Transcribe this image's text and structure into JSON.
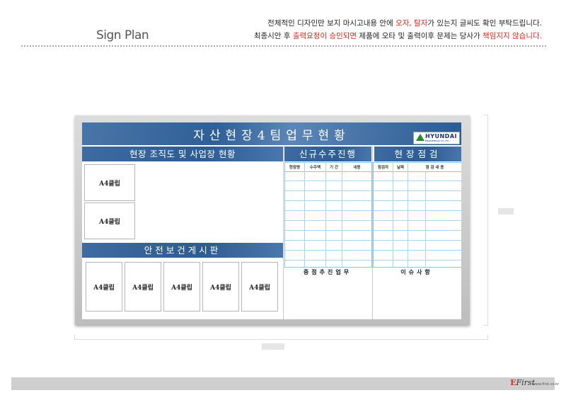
{
  "page": {
    "title": "Sign Plan"
  },
  "notice": {
    "line1_a": "전체적인 디자인만 보지 마시고내용 안에 ",
    "line1_b": "오자, 탈자",
    "line1_c": "가 있는지 글씨도 확인 부탁드립니다.",
    "line2_a": "최종시안 후 ",
    "line2_b": "출력요청이 승인되면",
    "line2_c": " 제품에 오타 및 출력이후 문제는 당사가 ",
    "line2_d": "책임지지 않습니다."
  },
  "footer": {
    "logo_mark": "E",
    "logo": "First",
    "sub": "www.first.co.kr"
  },
  "board": {
    "title": "자산현장4팀업무현황",
    "logo": {
      "name": "HYUNDAI",
      "sub": "ENGINEERING CO.,LTD."
    },
    "org_title": "현장 조직도 및 사업장 현황",
    "safety_title": "안전보건게시판",
    "new_title": "신규수주진행",
    "site_title": "현장점검",
    "clip_label": "A4클립",
    "new_headers": [
      "현장명",
      "수주액",
      "기 간",
      "내용"
    ],
    "site_headers": [
      "점검자",
      "날짜",
      "점 검 내 용"
    ],
    "new_footer": "중점추진업무",
    "site_footer": "이슈사항"
  },
  "colors": {
    "bar_blue": "#2d5b93",
    "notice_red": "#d8261d",
    "grid_line": "#a9d6ee"
  }
}
